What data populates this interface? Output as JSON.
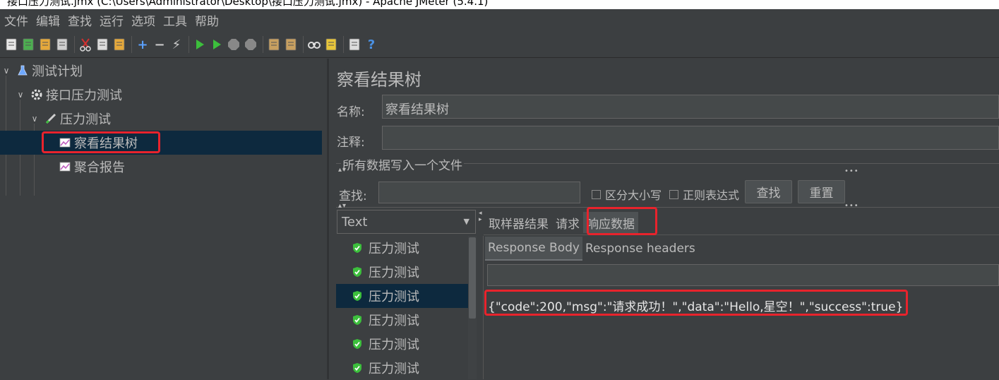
{
  "window": {
    "title": "接口压力测试.jmx (C:\\Users\\Administrator\\Desktop\\接口压力测试.jmx) - Apache JMeter (5.4.1)"
  },
  "menu": [
    "文件",
    "编辑",
    "查找",
    "运行",
    "选项",
    "工具",
    "帮助"
  ],
  "toolbar": [
    {
      "name": "new-icon",
      "color": "#e8e8e8"
    },
    {
      "name": "templates-icon",
      "color": "#4caf50"
    },
    {
      "name": "open-icon",
      "color": "#e6a93b"
    },
    {
      "name": "save-icon",
      "color": "#cfcfcf"
    },
    {
      "sep": true
    },
    {
      "name": "cut-icon",
      "color": "#d32f2f"
    },
    {
      "name": "copy-icon",
      "color": "#dddddd"
    },
    {
      "name": "paste-icon",
      "color": "#e6a93b"
    },
    {
      "sep": true
    },
    {
      "name": "expand-icon",
      "color": "#5aa0ff",
      "glyph": "+"
    },
    {
      "name": "collapse-icon",
      "color": "#cccccc",
      "glyph": "−"
    },
    {
      "name": "toggle-icon",
      "color": "#cccccc",
      "glyph": "⚡"
    },
    {
      "sep": true
    },
    {
      "name": "start-icon",
      "color": "#3cbf3c"
    },
    {
      "name": "start-no-pauses-icon",
      "color": "#3cbf3c"
    },
    {
      "name": "stop-icon",
      "color": "#888888"
    },
    {
      "name": "shutdown-icon",
      "color": "#888888"
    },
    {
      "sep": true
    },
    {
      "name": "clear-icon",
      "color": "#c8a060"
    },
    {
      "name": "clear-all-icon",
      "color": "#c8a060"
    },
    {
      "sep": true
    },
    {
      "name": "search-icon",
      "color": "#dddddd"
    },
    {
      "name": "reset-search-icon",
      "color": "#e8c63a"
    },
    {
      "sep": true
    },
    {
      "name": "function-helper-icon",
      "color": "#dddddd"
    },
    {
      "name": "help-icon",
      "color": "#4a90e2",
      "glyph": "?"
    }
  ],
  "tree": [
    {
      "label": "测试计划",
      "indent": 0,
      "chevron": "∨",
      "icon": "flask-icon"
    },
    {
      "label": "接口压力测试",
      "indent": 1,
      "chevron": "∨",
      "icon": "gear-icon"
    },
    {
      "label": "压力测试",
      "indent": 2,
      "chevron": "∨",
      "icon": "pencil-icon"
    },
    {
      "label": "察看结果树",
      "indent": 3,
      "chevron": "",
      "icon": "chart-icon",
      "selected": true
    },
    {
      "label": "聚合报告",
      "indent": 3,
      "chevron": "",
      "icon": "chart-icon"
    }
  ],
  "panel": {
    "title": "察看结果树",
    "name_label": "名称:",
    "name_value": "察看结果树",
    "comment_label": "注释:",
    "comment_value": "",
    "file_group_label": "所有数据写入一个文件",
    "search_label": "查找:",
    "search_value": "",
    "case_sensitive": "区分大小写",
    "regex": "正则表达式",
    "find_button": "查找",
    "reset_button": "重置",
    "renderer": "Text",
    "results": [
      {
        "label": "压力测试"
      },
      {
        "label": "压力测试"
      },
      {
        "label": "压力测试",
        "selected": true
      },
      {
        "label": "压力测试"
      },
      {
        "label": "压力测试"
      },
      {
        "label": "压力测试"
      }
    ],
    "tabs": [
      "取样器结果",
      "请求",
      "响应数据"
    ],
    "active_tab": "响应数据",
    "subtabs": [
      "Response Body",
      "Response headers"
    ],
    "active_subtab": "Response Body",
    "response_search_value": "",
    "response_body": "{\"code\":200,\"msg\":\"请求成功！\",\"data\":\"Hello,星空！\",\"success\":true}"
  },
  "colors": {
    "highlight": "#e8232c",
    "selection": "#0d293e",
    "background": "#3c3f41",
    "shield": "#3cbf3c"
  }
}
